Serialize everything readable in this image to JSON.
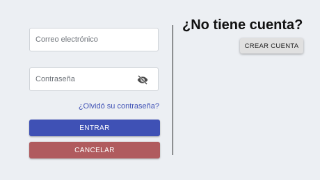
{
  "login": {
    "email_placeholder": "Correo electrónico",
    "email_value": "",
    "password_placeholder": "Contraseña",
    "password_value": "",
    "visibility_icon": "eye-off-icon",
    "forgot_link": "¿Olvidó su contraseña?",
    "enter_label": "ENTRAR",
    "cancel_label": "CANCELAR"
  },
  "signup": {
    "title": "¿No tiene cuenta?",
    "create_label": "CREAR CUENTA"
  },
  "colors": {
    "background": "#eceff3",
    "primary": "#3f51b5",
    "cancel": "#b05b5e",
    "secondary_button": "#e0e0e0",
    "link": "#3f51b5"
  }
}
